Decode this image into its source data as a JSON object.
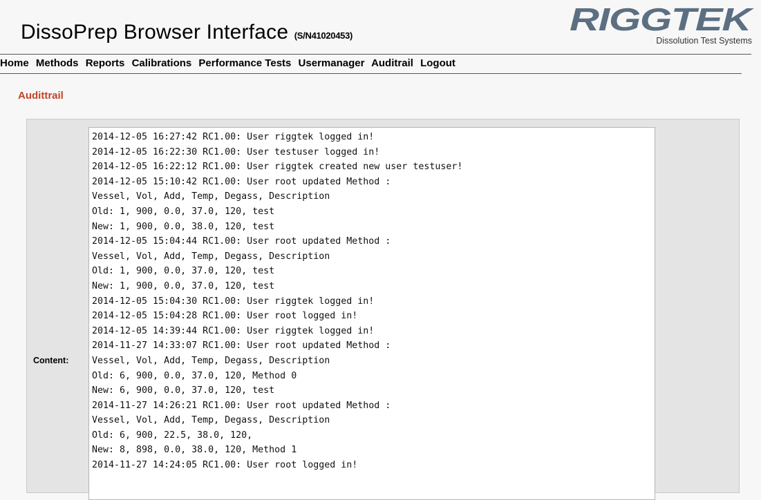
{
  "header": {
    "title": "DissoPrep Browser Interface",
    "serial": "(S/N41020453)",
    "logo_text": "RIGGTEK",
    "logo_tagline": "Dissolution Test Systems"
  },
  "nav": {
    "items": [
      {
        "label": "Home"
      },
      {
        "label": "Methods"
      },
      {
        "label": "Reports"
      },
      {
        "label": "Calibrations"
      },
      {
        "label": "Performance Tests"
      },
      {
        "label": "Usermanager"
      },
      {
        "label": "Auditrail"
      },
      {
        "label": "Logout"
      }
    ]
  },
  "section": {
    "title": "Audittrail"
  },
  "content": {
    "label": "Content:",
    "log_lines": [
      "2014-12-05 16:27:42 RC1.00: User riggtek logged in!",
      "2014-12-05 16:22:30 RC1.00: User testuser logged in!",
      "2014-12-05 16:22:12 RC1.00: User riggtek created new user testuser!",
      "2014-12-05 15:10:42 RC1.00: User root updated Method :",
      "Vessel, Vol, Add, Temp, Degass, Description",
      "Old: 1, 900, 0.0, 37.0, 120, test",
      "New: 1, 900, 0.0, 38.0, 120, test",
      "2014-12-05 15:04:44 RC1.00: User root updated Method :",
      "Vessel, Vol, Add, Temp, Degass, Description",
      "Old: 1, 900, 0.0, 37.0, 120, test",
      "New: 1, 900, 0.0, 37.0, 120, test",
      "2014-12-05 15:04:30 RC1.00: User riggtek logged in!",
      "2014-12-05 15:04:28 RC1.00: User root logged in!",
      "2014-12-05 14:39:44 RC1.00: User riggtek logged in!",
      "2014-11-27 14:33:07 RC1.00: User root updated Method :",
      "Vessel, Vol, Add, Temp, Degass, Description",
      "Old: 6, 900, 0.0, 37.0, 120, Method 0",
      "New: 6, 900, 0.0, 37.0, 120, test",
      "2014-11-27 14:26:21 RC1.00: User root updated Method :",
      "Vessel, Vol, Add, Temp, Degass, Description",
      "Old: 6, 900, 22.5, 38.0, 120,",
      "New: 8, 898, 0.0, 38.0, 120, Method 1",
      "2014-11-27 14:24:05 RC1.00: User root logged in!"
    ]
  },
  "colors": {
    "section_title": "#c0442a",
    "logo": "#5c6f82",
    "panel": "#e4e4e4",
    "background": "#f7f7f7"
  }
}
